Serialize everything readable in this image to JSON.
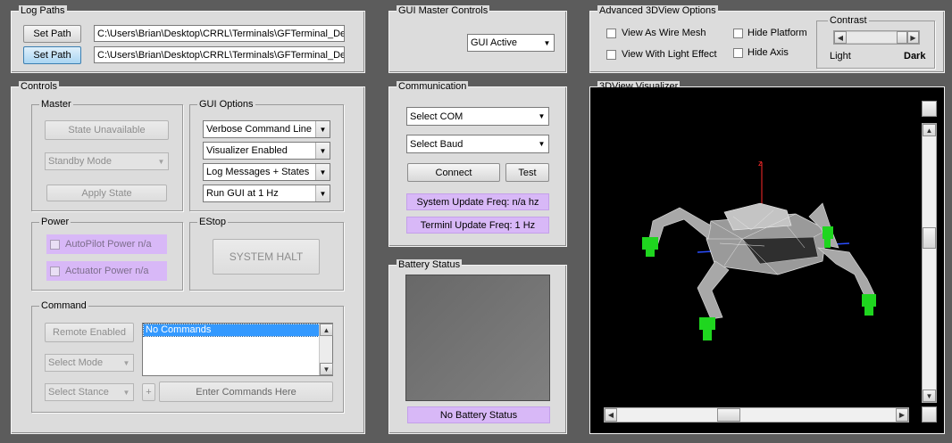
{
  "log_paths": {
    "title": "Log Paths",
    "rows": [
      {
        "button": "Set Path",
        "path": "C:\\Users\\Brian\\Desktop\\CRRL\\Terminals\\GFTerminal_Depl"
      },
      {
        "button": "Set Path",
        "path": "C:\\Users\\Brian\\Desktop\\CRRL\\Terminals\\GFTerminal_Depl"
      }
    ]
  },
  "gui_master": {
    "title": "GUI Master Controls",
    "select": "GUI Active"
  },
  "advanced_3d": {
    "title": "Advanced 3DView Options",
    "wire_mesh": "View As Wire Mesh",
    "light_effect": "View With Light Effect",
    "hide_platform": "Hide Platform",
    "hide_axis": "Hide Axis",
    "contrast": {
      "title": "Contrast",
      "light": "Light",
      "dark": "Dark"
    }
  },
  "controls": {
    "title": "Controls",
    "master": {
      "title": "Master",
      "state_button": "State Unavailable",
      "mode_select": "Standby Mode",
      "apply_button": "Apply State"
    },
    "gui_options": {
      "title": "GUI Options",
      "selects": [
        "Verbose Command Line",
        "Visualizer Enabled",
        "Log Messages + States",
        "Run GUI at 1 Hz"
      ]
    },
    "power": {
      "title": "Power",
      "autopilot": "AutoPilot Power n/a",
      "actuator": "Actuator Power n/a"
    },
    "estop": {
      "title": "EStop",
      "button": "SYSTEM HALT"
    },
    "command": {
      "title": "Command",
      "remote_button": "Remote Enabled",
      "mode_select": "Select Mode",
      "stance_select": "Select Stance",
      "list_item": "No Commands",
      "plus": "+",
      "input": "Enter Commands Here"
    }
  },
  "communication": {
    "title": "Communication",
    "com_select": "Select COM",
    "baud_select": "Select Baud",
    "connect": "Connect",
    "test": "Test",
    "system_freq": "System Update Freq: n/a hz",
    "terminal_freq": "Terminl Update Freq: 1 Hz"
  },
  "battery": {
    "title": "Battery Status",
    "status": "No Battery Status"
  },
  "visualizer": {
    "title": "3DView Visualizer",
    "axis_label": "z"
  },
  "colors": {
    "purple": "#d8b8f7",
    "panel": "#dcdcdc",
    "backdrop": "#5c5c5c",
    "robot_feet": "#1fd61f"
  },
  "icons": [
    "chevron-down-icon",
    "chevron-up-icon",
    "chevron-left-icon",
    "chevron-right-icon",
    "checkbox-icon"
  ]
}
